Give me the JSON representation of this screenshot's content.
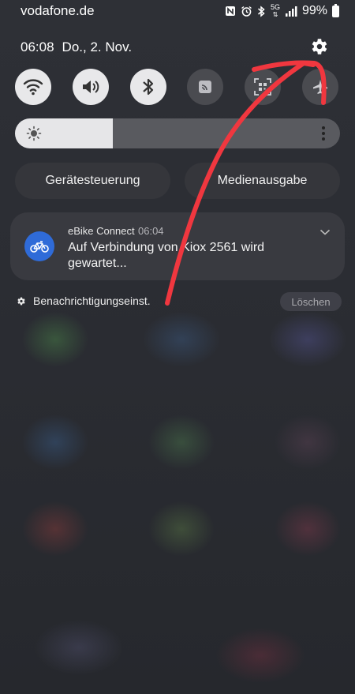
{
  "status_bar": {
    "carrier": "vodafone.de",
    "network": "5G",
    "battery": "99%",
    "icons": [
      "nfc-icon",
      "alarm-icon",
      "bluetooth-icon",
      "5g-icon",
      "signal-icon",
      "battery-icon"
    ]
  },
  "header": {
    "time": "06:08",
    "date": "Do., 2. Nov."
  },
  "quick_settings": [
    {
      "name": "wifi",
      "icon": "wifi-icon",
      "state": "on"
    },
    {
      "name": "sound",
      "icon": "speaker-icon",
      "state": "on"
    },
    {
      "name": "bluetooth",
      "icon": "bluetooth-icon",
      "state": "on"
    },
    {
      "name": "cast",
      "icon": "cast-icon",
      "state": "off"
    },
    {
      "name": "qr-scanner",
      "icon": "qr-scan-icon",
      "state": "off"
    },
    {
      "name": "airplane",
      "icon": "airplane-icon",
      "state": "off"
    }
  ],
  "brightness": {
    "level": 0.3
  },
  "buttons": {
    "device_control": "Gerätesteuerung",
    "media_output": "Medienausgabe"
  },
  "notification": {
    "app": "eBike Connect",
    "time": "06:04",
    "text": "Auf Verbindung von Kiox 2561 wird gewartet..."
  },
  "footer": {
    "settings_label": "Benachrichtigungseinst.",
    "clear_label": "Löschen"
  },
  "colors": {
    "accent": "#2f6bd8",
    "annotation": "#f0373f",
    "toggle_on": "#e8e8ea",
    "toggle_off": "#4a4b50"
  }
}
